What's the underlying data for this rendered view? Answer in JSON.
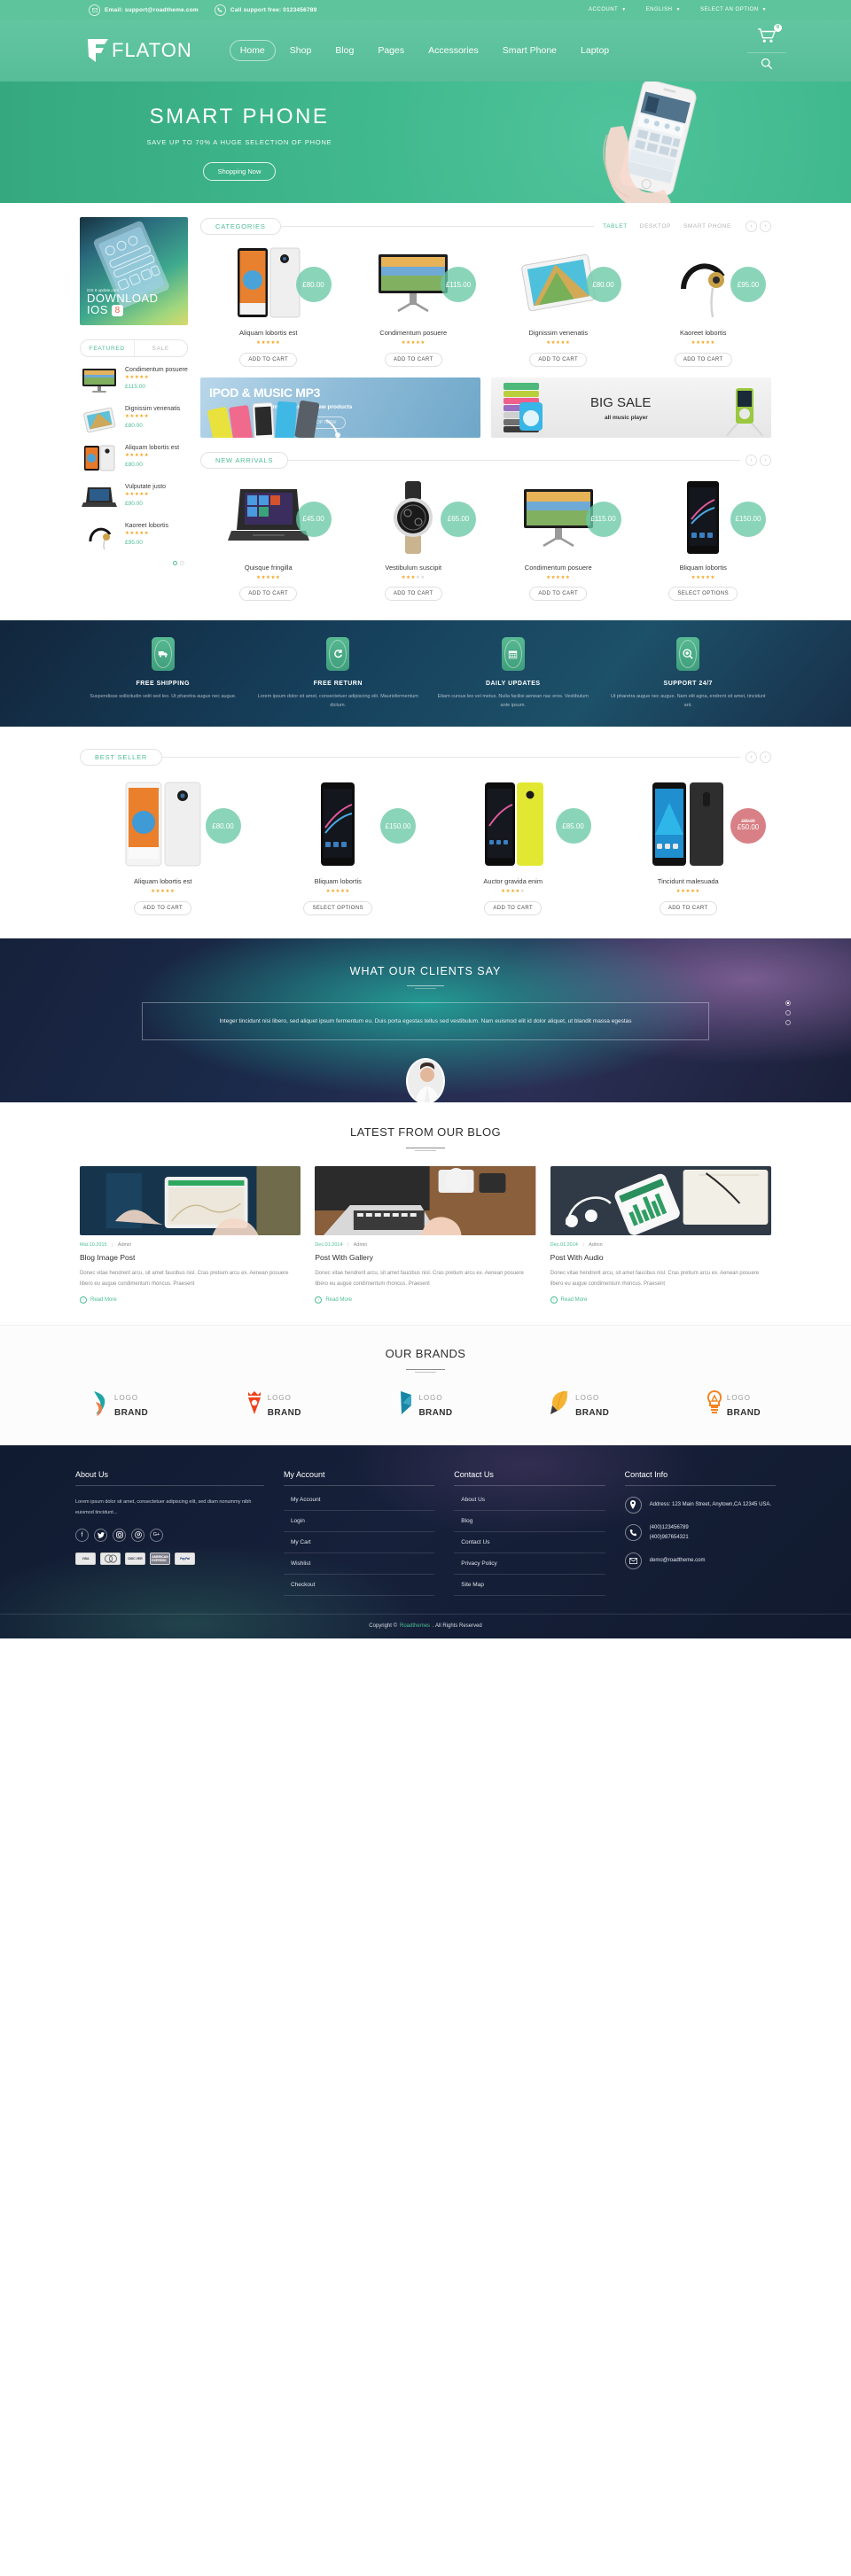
{
  "topbar": {
    "email_icon": "envelope-icon",
    "email": "Email: support@roadtheme.com",
    "phone_icon": "phone-icon",
    "phone": "Call support free: 0123456789",
    "account": "ACCOUNT",
    "language": "ENGLISH",
    "option": "SELECT AN OPTION"
  },
  "header": {
    "logo_text": "FLATON",
    "nav": [
      {
        "label": "Home",
        "active": true
      },
      {
        "label": "Shop",
        "active": false
      },
      {
        "label": "Blog",
        "active": false
      },
      {
        "label": "Pages",
        "active": false
      },
      {
        "label": "Accessories",
        "active": false
      },
      {
        "label": "Smart Phone",
        "active": false
      },
      {
        "label": "Laptop",
        "active": false
      }
    ],
    "cart_icon": "cart-icon",
    "cart_count": "0",
    "search_icon": "search-icon"
  },
  "hero": {
    "title": "SMART PHONE",
    "subtitle": "SAVE UP TO 70% A HUGE SELECTION OF PHONE",
    "button": "Shopping Now"
  },
  "sidebar": {
    "banner": {
      "small": "iOS 8 update.com",
      "line1": "DOWNLOAD",
      "line2": "IOS",
      "badge": "8"
    },
    "tabs": [
      {
        "label": "FEATURED",
        "active": true
      },
      {
        "label": "SALE",
        "active": false
      }
    ],
    "items": [
      {
        "name": "Condimentum posuere",
        "stars": 5,
        "price": "£115.00",
        "thumb": "monitor"
      },
      {
        "name": "Dignissim venenatis",
        "stars": 5,
        "price": "£80.00",
        "thumb": "tablet"
      },
      {
        "name": "Aliquam lobortis est",
        "stars": 5,
        "price": "£80.00",
        "thumb": "phone-pair"
      },
      {
        "name": "Vulputate justo",
        "stars": 5,
        "price": "£90.00",
        "thumb": "laptop"
      },
      {
        "name": "Kaoreet lobortis",
        "stars": 5,
        "price": "£95.00",
        "thumb": "headphone"
      }
    ]
  },
  "categories": {
    "title": "CATEGORIES",
    "tabs": [
      {
        "label": "TABLET",
        "active": true
      },
      {
        "label": "DESKTOP",
        "active": false
      },
      {
        "label": "SMART PHONE",
        "active": false
      }
    ],
    "prev": "‹",
    "next": "›",
    "products": [
      {
        "name": "Aliquam lobortis est",
        "price": "£80.00",
        "stars": 5,
        "cta": "ADD TO CART",
        "img": "phone-pair"
      },
      {
        "name": "Condimentum posuere",
        "price": "£115.00",
        "stars": 5,
        "cta": "ADD TO CART",
        "img": "monitor"
      },
      {
        "name": "Dignissim venenatis",
        "price": "£80.00",
        "stars": 5,
        "cta": "ADD TO CART",
        "img": "tablet"
      },
      {
        "name": "Kaoreet lobortis",
        "price": "£95.00",
        "stars": 5,
        "cta": "ADD TO CART",
        "img": "headphone"
      }
    ]
  },
  "promos": {
    "left": {
      "title": "IPOD & MUSIC MP3",
      "subtitle": "introducing the new products",
      "button": "SHOP NOW"
    },
    "right": {
      "title": "BIG SALE",
      "subtitle": "all music player"
    }
  },
  "new_arrivals": {
    "title": "NEW ARRIVALS",
    "prev": "‹",
    "next": "›",
    "products": [
      {
        "name": "Quisque fringilla",
        "price": "£45.00",
        "stars": 5,
        "cta": "ADD TO CART",
        "img": "laptop"
      },
      {
        "name": "Vestibulum suscipit",
        "price": "£65.00",
        "stars": 3.5,
        "cta": "ADD TO CART",
        "img": "watch"
      },
      {
        "name": "Condimentum posuere",
        "price": "£115.00",
        "stars": 5,
        "cta": "ADD TO CART",
        "img": "monitor"
      },
      {
        "name": "Bliquam lobortis",
        "price": "£150.00",
        "stars": 5,
        "cta": "SELECT OPTIONS",
        "img": "phone-dark"
      }
    ]
  },
  "services": [
    {
      "icon": "truck-icon",
      "title": "FREE SHIPPING",
      "desc": "Suspendisse sollicitudin velit sed leo. Ut pharetra augue nec augue."
    },
    {
      "icon": "refresh-icon",
      "title": "FREE RETURN",
      "desc": "Lorem ipsum dolor sit amet, consectetuer adipiscing elit. Maurisfermentum dictum."
    },
    {
      "icon": "calendar-icon",
      "title": "DAILY UPDATES",
      "desc": "Etiam cursus leo vel metus. Nulla facilisi aenean nac eros. Vestibulum ante ipsum."
    },
    {
      "icon": "support-icon",
      "title": "SUPPORT 24/7",
      "desc": "Ut pharetra augue nec augue. Nam elit agna, endrent sit amet, tincidunt ant."
    }
  ],
  "best_seller": {
    "title": "BEST SELLER",
    "prev": "‹",
    "next": "›",
    "products": [
      {
        "name": "Aliquam lobortis est",
        "price": "£80.00",
        "old_price": "",
        "stars": 5,
        "cta": "ADD TO CART",
        "img": "phone-pair",
        "sale": false
      },
      {
        "name": "Bliquam lobortis",
        "price": "£150.00",
        "old_price": "",
        "stars": 5,
        "cta": "SELECT OPTIONS",
        "img": "phone-dark",
        "sale": false
      },
      {
        "name": "Auctor gravida enim",
        "price": "£85.00",
        "old_price": "",
        "stars": 4,
        "cta": "ADD TO CART",
        "img": "phone-yellow",
        "sale": false
      },
      {
        "name": "Tincidunt malesuada",
        "price": "£50.00",
        "old_price": "£80.00",
        "stars": 5,
        "cta": "ADD TO CART",
        "img": "phone-blue",
        "sale": true
      }
    ]
  },
  "testimonial": {
    "title": "WHAT OUR CLIENTS SAY",
    "quote": "Integer tincidunt nisi libero, sed aliquet ipsum fermentum eu. Duis porta egestas tellus sed vestibulum. Nam euismod elit id dolor aliquet, ut blandit massa egestas",
    "dots": 3,
    "active_dot": 0
  },
  "blog": {
    "title": "LATEST FROM OUR BLOG",
    "posts": [
      {
        "date": "Mar.10.2015",
        "author": "Admin",
        "title": "Blog Image Post",
        "excerpt": "Donec vitae hendrerit arcu, sit amet faucibus nisl. Cras pretium arcu ex. Aenean posuere libero eu augue condimentum rhoncus. Praesent",
        "more": "Read More",
        "img": "tablet-map"
      },
      {
        "date": "Dec.01.2014",
        "author": "Admin",
        "title": "Post With Gallery",
        "excerpt": "Donec vitae hendrerit arcu, sit amet faucibus nisl. Cras pretium arcu ex. Aenean posuere libero eu augue condimentum rhoncus. Praesent",
        "more": "Read More",
        "img": "laptop-desk"
      },
      {
        "date": "Dec.01.2014",
        "author": "Admin",
        "title": "Post With Audio",
        "excerpt": "Donec vitae hendrerit arcu, sit amet faucibus nisl. Cras pretium arcu ex. Aenean posuere libero eu augue condimentum rhoncus. Praesent",
        "more": "Read More",
        "img": "phone-earbuds"
      }
    ]
  },
  "brands": {
    "title": "OUR BRANDS",
    "items": [
      {
        "logo_word": "LOGO",
        "name": "BRAND",
        "color": "#1ea5a5",
        "icon": "swoosh-icon"
      },
      {
        "logo_word": "LOGO",
        "name": "BRAND",
        "color": "#f0411c",
        "icon": "crown-pin-icon"
      },
      {
        "logo_word": "LOGO",
        "name": "BRAND",
        "color": "#1787a6",
        "icon": "facet-icon"
      },
      {
        "logo_word": "LOGO",
        "name": "BRAND",
        "color": "#f5b335",
        "icon": "pencil-icon"
      },
      {
        "logo_word": "LOGO",
        "name": "BRAND",
        "color": "#f58220",
        "icon": "bulb-icon"
      }
    ]
  },
  "footer": {
    "about": {
      "title": "About Us",
      "text": "Lorem ipsum dolor sit amet, consectetuer adipiscing elit, sed diam nonummy nibh euismod tincidunt...",
      "social": [
        {
          "name": "facebook-icon",
          "glyph": "f"
        },
        {
          "name": "twitter-icon",
          "glyph": "t"
        },
        {
          "name": "instagram-icon",
          "glyph": "i"
        },
        {
          "name": "pinterest-icon",
          "glyph": "p"
        },
        {
          "name": "google-plus-icon",
          "glyph": "G+"
        }
      ],
      "payments": [
        "VISA",
        "MASTERCARD",
        "DISCOVER",
        "AMERICAN EXPRESS",
        "PayPal"
      ]
    },
    "account": {
      "title": "My Account",
      "links": [
        "My Account",
        "Login",
        "My Cart",
        "Wishlist",
        "Checkout"
      ]
    },
    "contact_us": {
      "title": "Contact Us",
      "links": [
        "About Us",
        "Blog",
        "Contact Us",
        "Privacy Policy",
        "Site Map"
      ]
    },
    "contact_info": {
      "title": "Contact Info",
      "address_icon": "location-pin-icon",
      "address": "Address: 123 Main Street, Anytown,CA 12345 USA.",
      "phone_icon": "phone-icon",
      "phone1": "(400)123456789",
      "phone2": "(400)987654321",
      "email_icon": "envelope-icon",
      "email": "demo@roadtheme.com"
    },
    "copyright_pre": "Copyright ©",
    "copyright_brand": "Roadthemes",
    "copyright_post": ". All Rights Reserved"
  },
  "colors": {
    "accent": "#4cbd95",
    "header": "#5ec49b",
    "star": "#f5a623",
    "sale": "#d16a70",
    "footer_dark": "#101a30"
  }
}
